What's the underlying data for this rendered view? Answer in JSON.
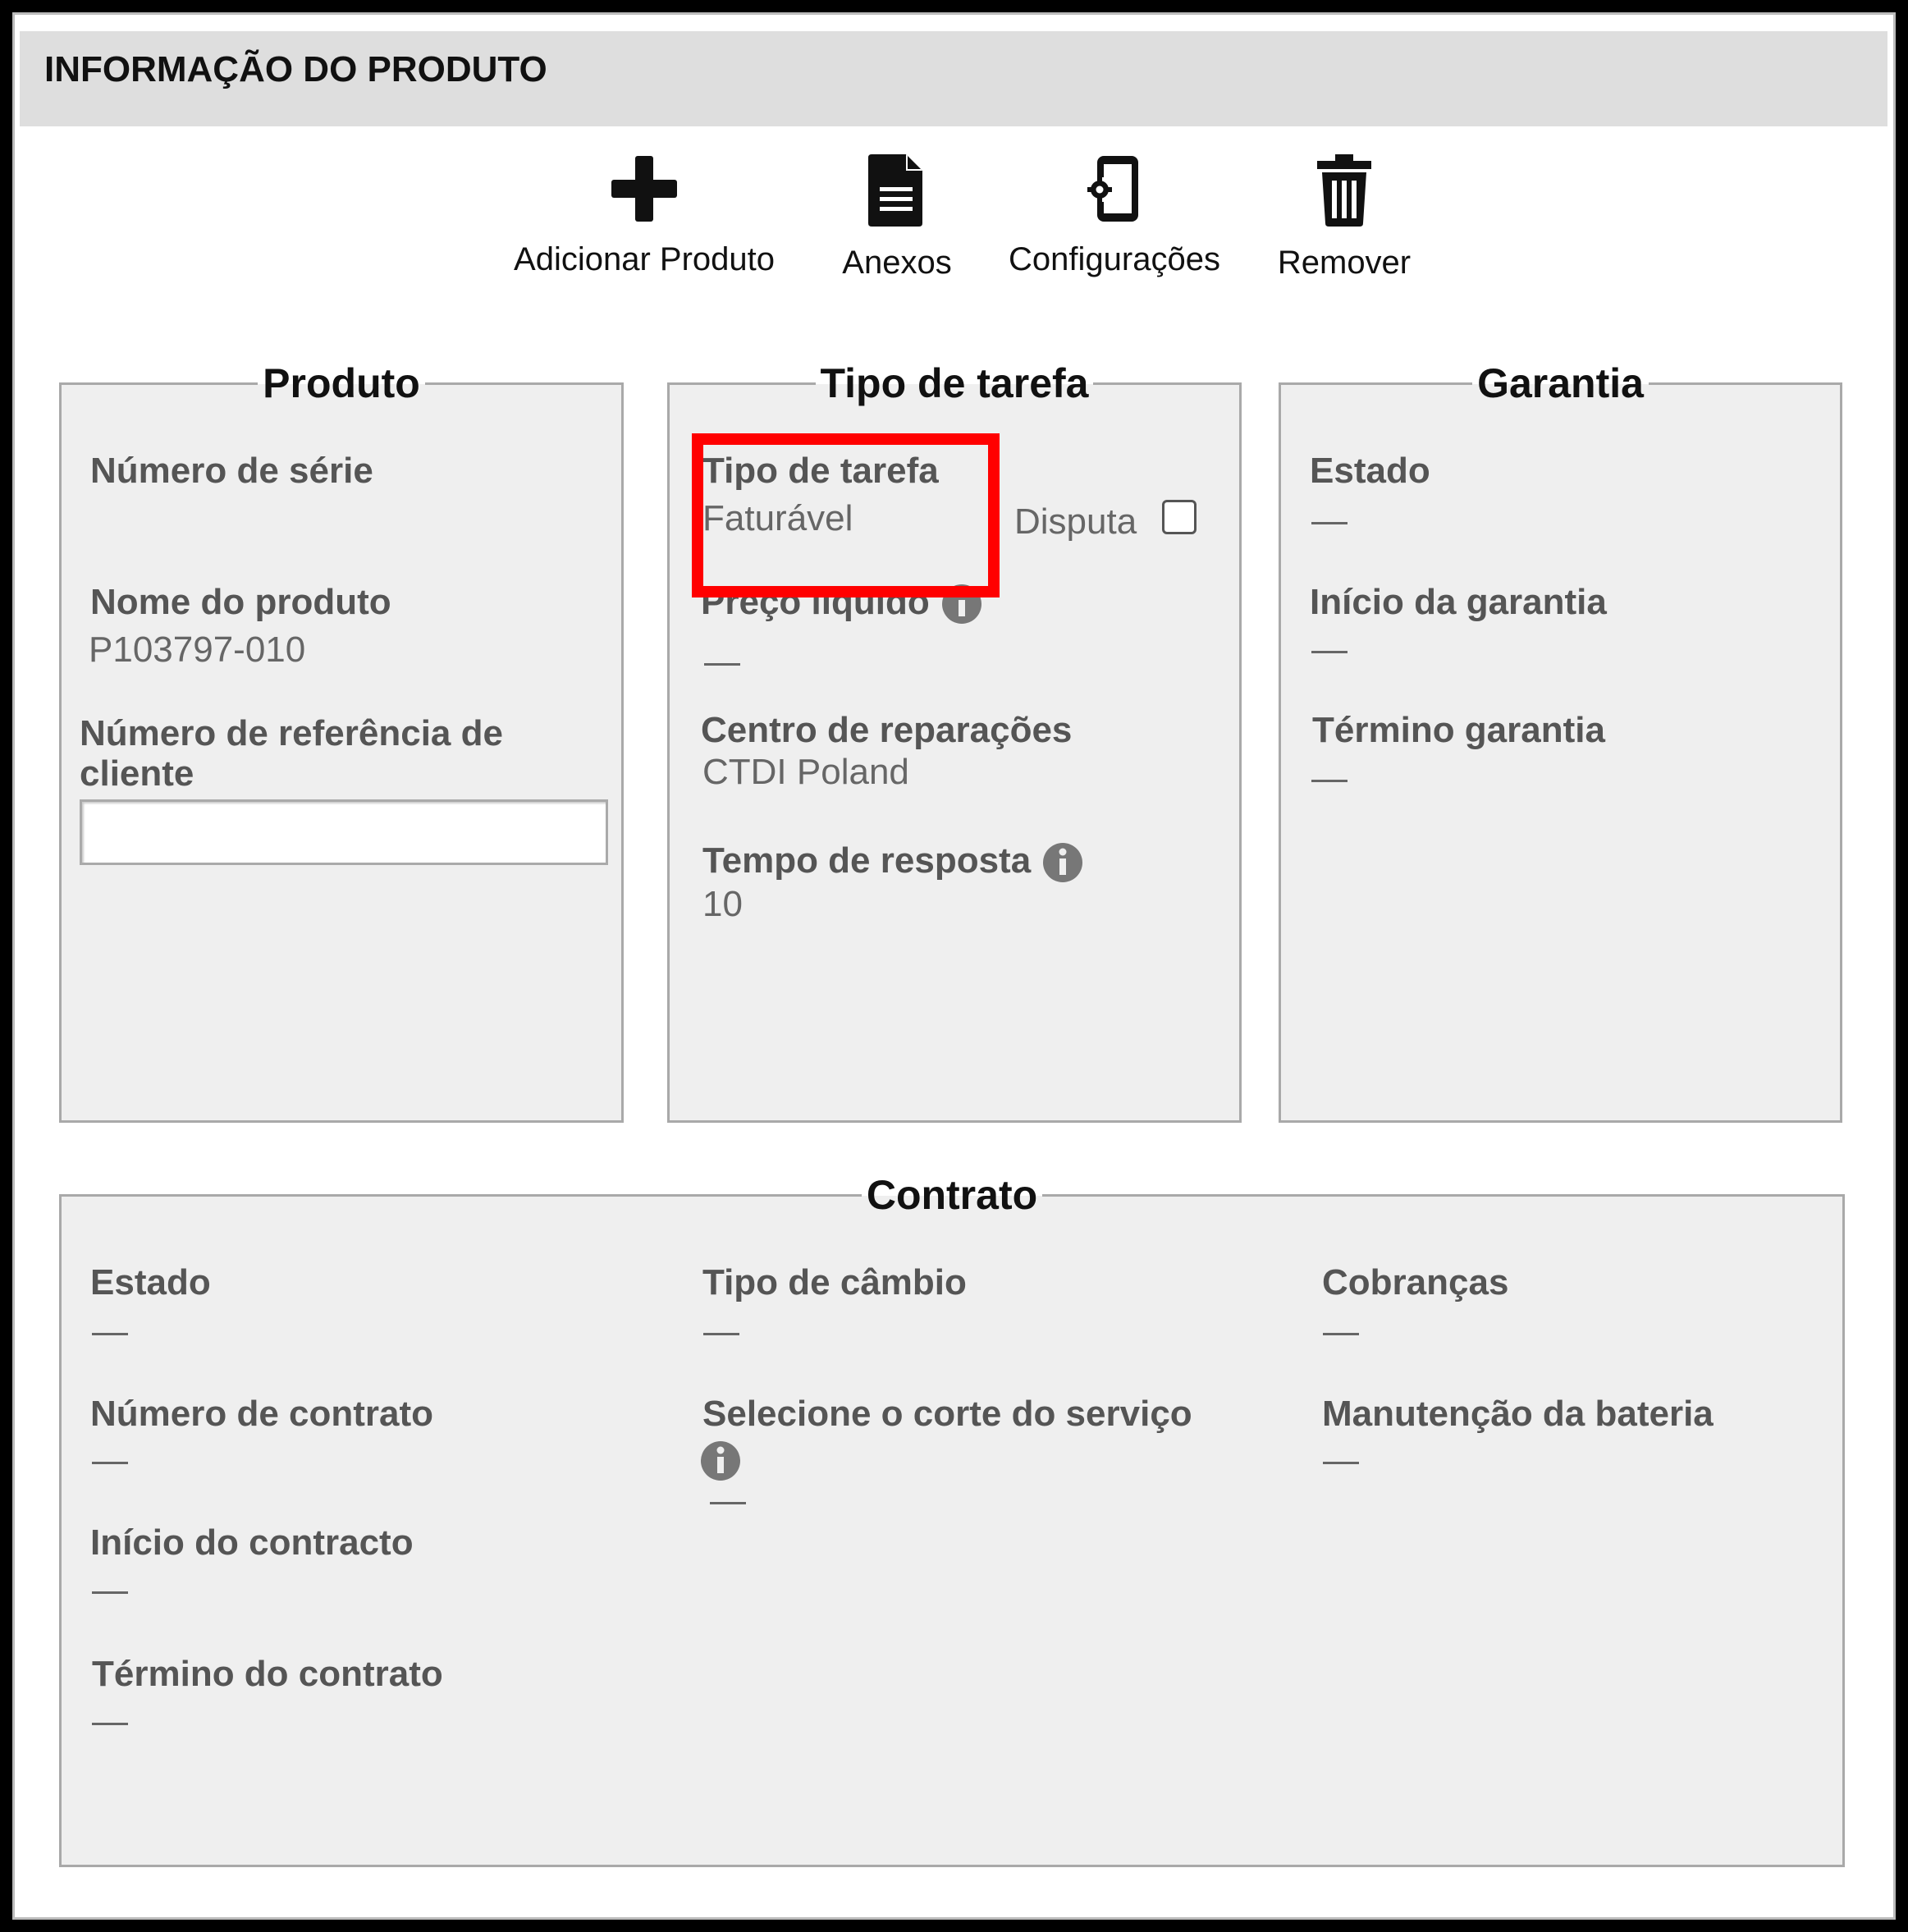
{
  "header": {
    "title": "INFORMAÇÃO DO PRODUTO"
  },
  "toolbar": {
    "add_product": {
      "label": "Adicionar Produto",
      "icon": "plus-icon"
    },
    "attachments": {
      "label": "Anexos",
      "icon": "document-icon"
    },
    "settings": {
      "label": "Configurações",
      "icon": "device-settings-icon"
    },
    "remove": {
      "label": "Remover",
      "icon": "trash-icon"
    }
  },
  "product": {
    "title": "Produto",
    "serial_label": "Número de série",
    "serial_value": "",
    "name_label": "Nome do produto",
    "name_value": "P103797-010",
    "ref_label_line1": "Número de referência de",
    "ref_label_line2": "cliente",
    "ref_value": ""
  },
  "task": {
    "title": "Tipo de tarefa",
    "type_label": "Tipo de tarefa",
    "type_value": "Faturável",
    "dispute_label": "Disputa",
    "dispute_checked": false,
    "net_price_label": "Preço líquido",
    "net_price_value": "—",
    "repair_center_label": "Centro de reparações",
    "repair_center_value": "CTDI Poland",
    "response_time_label": "Tempo de resposta",
    "response_time_value": "10"
  },
  "warranty": {
    "title": "Garantia",
    "status_label": "Estado",
    "status_value": "—",
    "start_label": "Início da garantia",
    "start_value": "—",
    "end_label": "Término garantia",
    "end_value": "—"
  },
  "contract": {
    "title": "Contrato",
    "status_label": "Estado",
    "status_value": "—",
    "number_label": "Número de contrato",
    "number_value": "—",
    "start_label": "Início do contracto",
    "start_value": "—",
    "end_label": "Término do contrato",
    "end_value": "—",
    "exchange_label": "Tipo de câmbio",
    "exchange_value": "—",
    "service_cut_label": "Selecione o corte do serviço",
    "service_cut_value": "—",
    "charges_label": "Cobranças",
    "charges_value": "—",
    "battery_label": "Manutenção da bateria",
    "battery_value": "—"
  },
  "colors": {
    "highlight": "#ff0000",
    "panel_bg": "#efefef",
    "header_bg": "#dedede"
  }
}
